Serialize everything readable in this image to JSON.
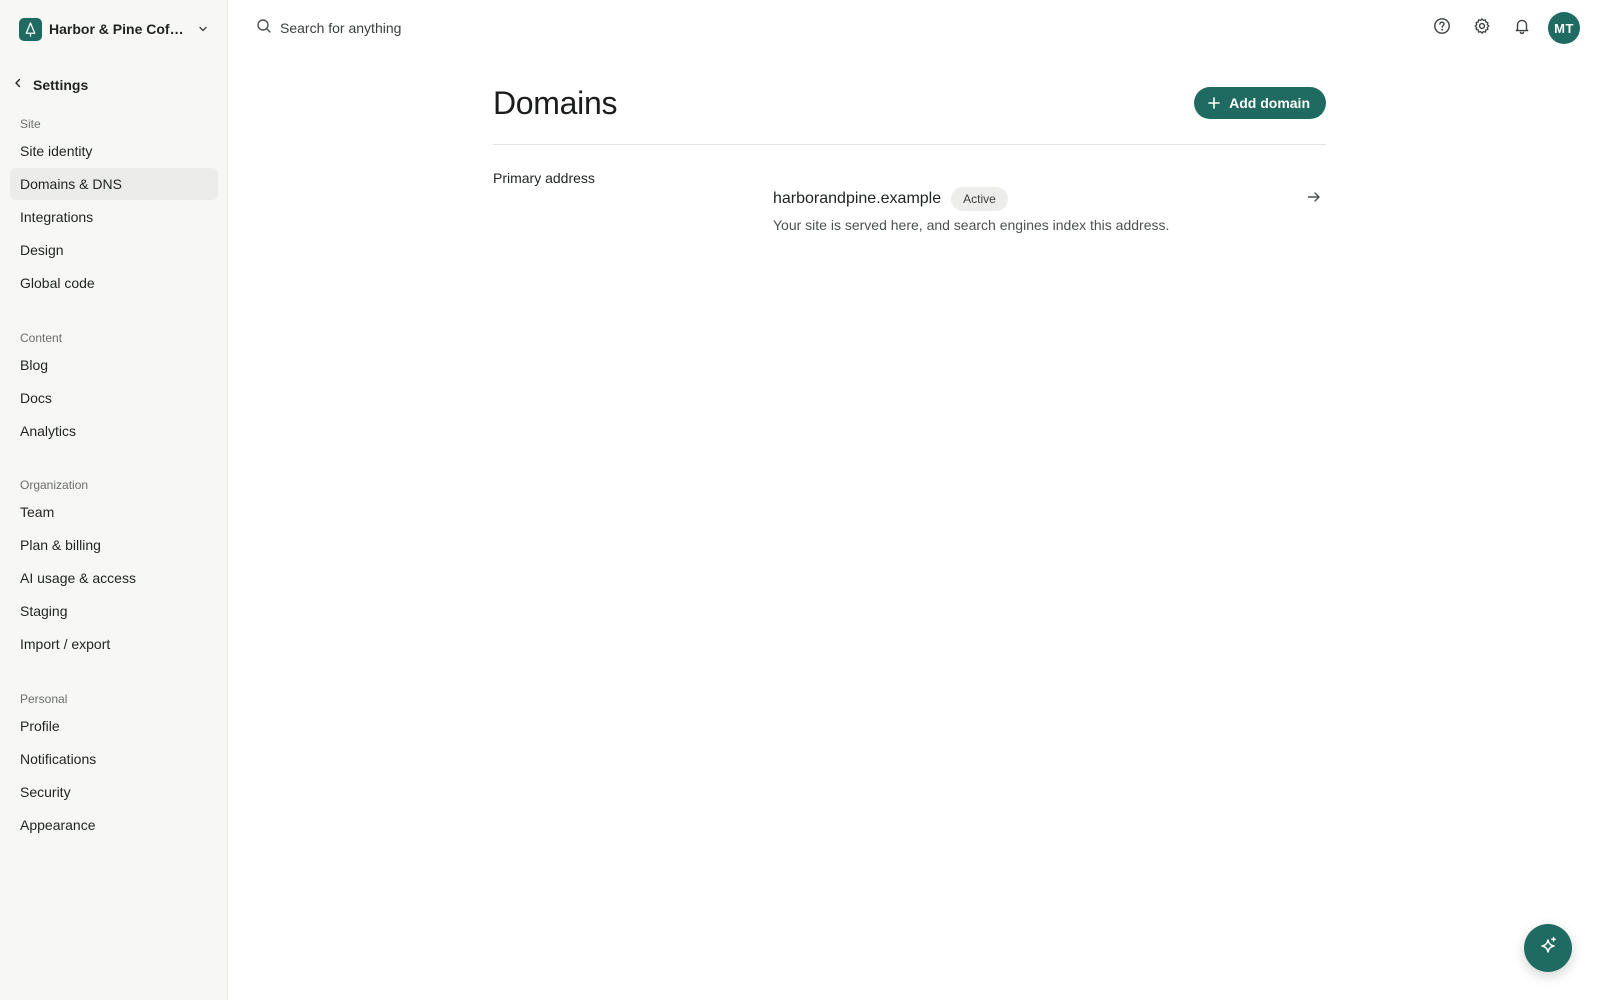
{
  "workspace": {
    "name": "Harbor & Pine Coff…",
    "logo_icon": "pine-tree-icon"
  },
  "sidebar": {
    "back_label": "Settings",
    "groups": [
      {
        "label": "Site",
        "items": [
          {
            "label": "Site identity"
          },
          {
            "label": "Domains & DNS",
            "active": true
          },
          {
            "label": "Integrations"
          },
          {
            "label": "Design"
          },
          {
            "label": "Global code"
          }
        ]
      },
      {
        "label": "Content",
        "items": [
          {
            "label": "Blog"
          },
          {
            "label": "Docs"
          },
          {
            "label": "Analytics"
          }
        ]
      },
      {
        "label": "Organization",
        "items": [
          {
            "label": "Team"
          },
          {
            "label": "Plan & billing"
          },
          {
            "label": "AI usage & access"
          },
          {
            "label": "Staging"
          },
          {
            "label": "Import / export"
          }
        ]
      },
      {
        "label": "Personal",
        "items": [
          {
            "label": "Profile"
          },
          {
            "label": "Notifications"
          },
          {
            "label": "Security"
          },
          {
            "label": "Appearance"
          }
        ]
      }
    ]
  },
  "topbar": {
    "search_placeholder": "Search for anything",
    "avatar_initials": "MT"
  },
  "page": {
    "title": "Domains",
    "add_button_label": "Add domain",
    "section_label": "Primary address",
    "domain": {
      "name": "harborandpine.example",
      "status": "Active",
      "description": "Your site is served here, and search engines index this address."
    }
  },
  "colors": {
    "accent": "#1f6b62",
    "sidebar_bg": "#f7f7f6",
    "active_item_bg": "#ececea"
  }
}
